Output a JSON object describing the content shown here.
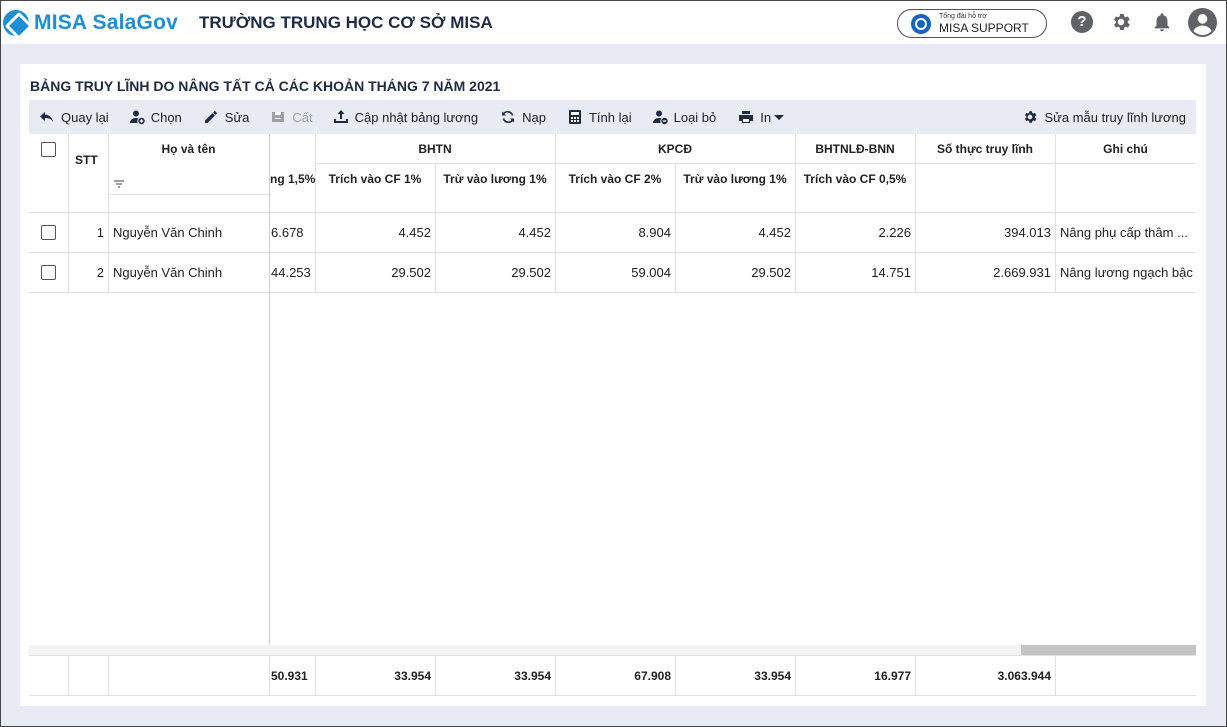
{
  "app": {
    "brand": "MISA SalaGov",
    "org_name": "TRƯỜNG TRUNG HỌC CƠ SỞ MISA",
    "support_caption": "Tổng đài hỗ trợ",
    "support_label": "MISA SUPPORT",
    "help_glyph": "?"
  },
  "page": {
    "title": "BẢNG TRUY LĨNH DO NÂNG TẤT CẢ CÁC KHOẢN THÁNG 7 NĂM 2021"
  },
  "toolbar": {
    "back": "Quay lại",
    "choose": "Chọn",
    "edit": "Sửa",
    "save": "Cất",
    "update_payroll": "Cập nhật bảng lương",
    "reload": "Nạp",
    "recalc": "Tính lại",
    "remove": "Loại bỏ",
    "print": "In",
    "edit_template": "Sửa mẫu truy lĩnh lương"
  },
  "grid": {
    "headers": {
      "stt": "STT",
      "name": "Họ và tên",
      "partial_col": "ng 1,5%",
      "bhtn": "BHTN",
      "bhtn_cf": "Trích vào CF 1%",
      "bhtn_salary": "Trừ vào lương 1%",
      "kpcd": "KPCĐ",
      "kpcd_cf": "Trích vào CF 2%",
      "kpcd_salary": "Trừ vào lương 1%",
      "bhtnld": "BHTNLĐ-BNN",
      "bhtnld_cf": "Trích vào CF 0,5%",
      "net": "Số thực truy lĩnh",
      "note": "Ghi chú"
    },
    "rows": [
      {
        "stt": "1",
        "name": "Nguyễn Văn Chinh",
        "partial": "6.678",
        "bhtn_cf": "4.452",
        "bhtn_salary": "4.452",
        "kpcd_cf": "8.904",
        "kpcd_salary": "4.452",
        "bhtnld_cf": "2.226",
        "net": "394.013",
        "note": "Nâng phụ cấp thâm ..."
      },
      {
        "stt": "2",
        "name": "Nguyễn Văn Chinh",
        "partial": "44.253",
        "bhtn_cf": "29.502",
        "bhtn_salary": "29.502",
        "kpcd_cf": "59.004",
        "kpcd_salary": "29.502",
        "bhtnld_cf": "14.751",
        "net": "2.669.931",
        "note": "Nâng lương ngạch bậc"
      }
    ],
    "totals": {
      "partial": "50.931",
      "bhtn_cf": "33.954",
      "bhtn_salary": "33.954",
      "kpcd_cf": "67.908",
      "kpcd_salary": "33.954",
      "bhtnld_cf": "16.977",
      "net": "3.063.944"
    }
  },
  "colors": {
    "brand": "#1e8fd7",
    "toolbar_bg": "#e8ebf3"
  }
}
